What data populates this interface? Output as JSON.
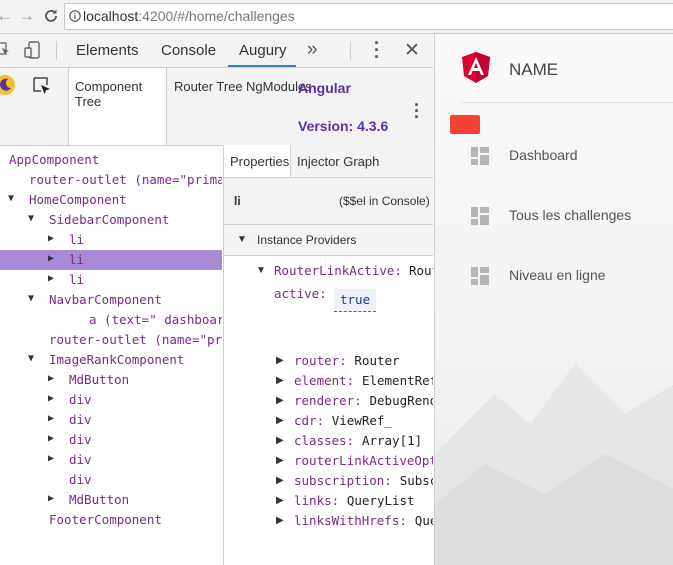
{
  "browser": {
    "url_host": "localhost",
    "url_path": ":4200/#/home/challenges"
  },
  "devtools": {
    "tabs": [
      "Elements",
      "Console",
      "Augury"
    ],
    "more_tabs_glyph": "»",
    "augury": {
      "subtabs": [
        "Component Tree",
        "Router Tree",
        "NgModules"
      ],
      "brand": "Angular",
      "version": "Version: 4.3.6",
      "tree": [
        {
          "text": "AppComponent",
          "level": 0,
          "arrow": "down"
        },
        {
          "text": "router-outlet (name=\"prima",
          "level": 1,
          "arrow": ""
        },
        {
          "text": "HomeComponent",
          "level": 1,
          "arrow": "down"
        },
        {
          "text": "SidebarComponent",
          "level": 2,
          "arrow": "down"
        },
        {
          "text": "li",
          "level": 3,
          "arrow": "right"
        },
        {
          "text": "li",
          "level": 3,
          "arrow": "right",
          "selected": true
        },
        {
          "text": "li",
          "level": 3,
          "arrow": "right"
        },
        {
          "text": "NavbarComponent",
          "level": 2,
          "arrow": "down"
        },
        {
          "text": "a (text=\" dashboard (",
          "level": 4,
          "arrow": ""
        },
        {
          "text": "router-outlet (name=\"pr",
          "level": 2,
          "arrow": ""
        },
        {
          "text": "ImageRankComponent",
          "level": 2,
          "arrow": "down"
        },
        {
          "text": "MdButton",
          "level": 3,
          "arrow": "right"
        },
        {
          "text": "div",
          "level": 3,
          "arrow": "right"
        },
        {
          "text": "div",
          "level": 3,
          "arrow": "right"
        },
        {
          "text": "div",
          "level": 3,
          "arrow": "right"
        },
        {
          "text": "div",
          "level": 3,
          "arrow": "right"
        },
        {
          "text": "div",
          "level": 3,
          "arrow": ""
        },
        {
          "text": "MdButton",
          "level": 3,
          "arrow": "right"
        },
        {
          "text": "FooterComponent",
          "level": 2,
          "arrow": ""
        }
      ],
      "props": {
        "tabs": [
          "Properties",
          "Injector Graph"
        ],
        "element": "li",
        "console_hint": "($$el in Console)",
        "section": "Instance Providers",
        "provider_name": "RouterLinkActive:",
        "provider_value": "Rout",
        "active_key": "active:",
        "active_value": "true",
        "rows": [
          {
            "key": "router:",
            "value": "Router"
          },
          {
            "key": "element:",
            "value": "ElementRef"
          },
          {
            "key": "renderer:",
            "value": "DebugRende"
          },
          {
            "key": "cdr:",
            "value": "ViewRef_"
          },
          {
            "key": "classes:",
            "value": "Array[1]"
          },
          {
            "key": "routerLinkActiveOpt",
            "value": ""
          },
          {
            "key": "subscription:",
            "value": "Subsc"
          },
          {
            "key": "links:",
            "value": "QueryList"
          },
          {
            "key": "linksWithHrefs:",
            "value": "Que"
          }
        ]
      }
    }
  },
  "app": {
    "brand_name": "NAME",
    "nav": [
      "Dashboard",
      "Tous les challenges",
      "Niveau en ligne"
    ],
    "colors": {
      "accent_red": "#f44336",
      "angular_red": "#dd0031",
      "augury_purple": "#5b2fa3",
      "tree_purple": "#7b2a8c",
      "selected_row": "#a98ad6"
    }
  }
}
